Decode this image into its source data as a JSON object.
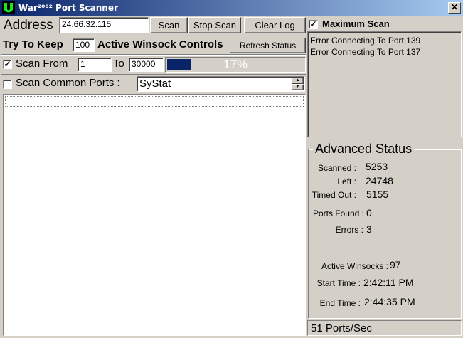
{
  "window": {
    "title": "War²⁰⁰² Port Scanner",
    "close_label": "✕"
  },
  "toolbar": {
    "address_label": "Address",
    "address_value": "24.66.32.115",
    "scan_label": "Scan",
    "stop_scan_label": "Stop Scan",
    "clear_log_label": "Clear Log",
    "try_label": "Try To Keep",
    "keep_value": "100",
    "active_label": "Active Winsock Controls",
    "refresh_label": "Refresh Status",
    "scan_from_label": "Scan From",
    "scan_from_checked": true,
    "from_value": "1",
    "to_label": "To",
    "to_value": "30000",
    "progress_fraction": 0.17,
    "progress_text": "17%",
    "progress_color": "#0a246a",
    "common_ports_label": "Scan Common Ports :",
    "common_ports_checked": false,
    "common_ports_selected": "SyStat"
  },
  "right_panel": {
    "max_scan_label": "Maximum Scan",
    "max_scan_checked": true,
    "errors": [
      "Error Connecting To Port 139",
      "Error Connecting To Port 137"
    ],
    "advanced_title": "Advanced Status",
    "scanned_label": "Scanned :",
    "scanned_value": "5253",
    "left_label": "Left :",
    "left_value": "24748",
    "timed_out_label": "Timed Out :",
    "timed_out_value": "5155",
    "ports_found_label": "Ports Found :",
    "ports_found_value": "0",
    "errors_label": "Errors :",
    "errors_value": "3",
    "active_winsocks_label": "Active Winsocks :",
    "active_winsocks_value": "97",
    "start_time_label": "Start Time :",
    "start_time_value": "2:42:11 PM",
    "end_time_label": "End Time :",
    "end_time_value": "2:44:35 PM",
    "rate_text": "51 Ports/Sec"
  }
}
